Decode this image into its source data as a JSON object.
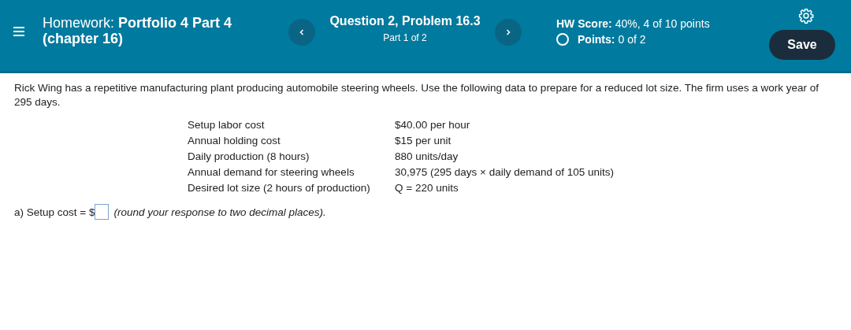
{
  "header": {
    "title": "Homework: **Portfolio 4 Part 4 (chapter 16)**",
    "question": {
      "title": "Question 2, Problem 16.3",
      "part": "Part 1 of 2"
    },
    "score": {
      "label": "HW Score:",
      "value": "40%, 4 of 10 points"
    },
    "points": {
      "label": "Points:",
      "value": "0 of 2"
    },
    "save_button": "Save"
  },
  "problem": {
    "intro": "Rick Wing has a repetitive manufacturing plant producing automobile steering wheels. Use the following data to prepare for a reduced lot size. The firm uses a work year of 295 days.",
    "data_rows": [
      {
        "label": "Setup labor cost",
        "value": "$40.00 per hour"
      },
      {
        "label": "Annual holding cost",
        "value": "$15 per unit"
      },
      {
        "label": "Daily production (8 hours)",
        "value": "880 units/day"
      },
      {
        "label": "Annual demand for steering wheels",
        "value": "30,975 (295 days × daily demand of 105 units)"
      },
      {
        "label": "Desired lot size (2 hours of production)",
        "value": "Q = 220 units"
      }
    ],
    "answer": {
      "prompt": "a) Setup cost = $",
      "hint": "(round your response to two decimal places)."
    }
  }
}
